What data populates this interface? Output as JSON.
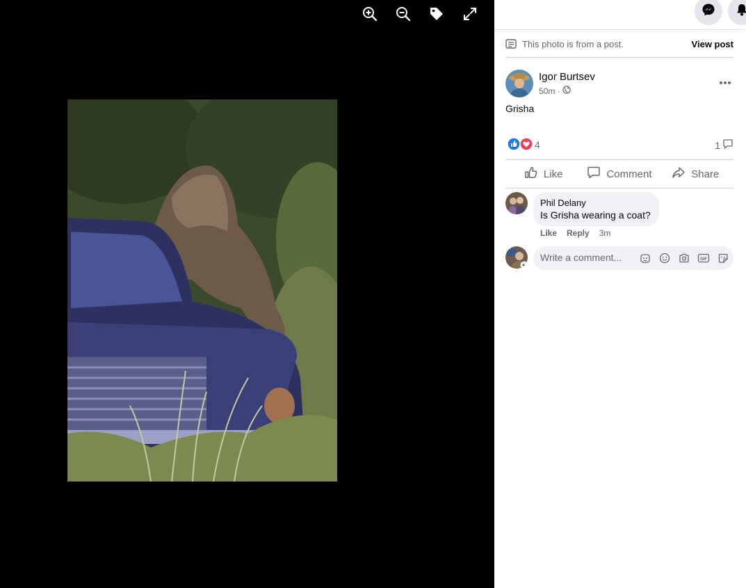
{
  "viewer": {
    "tools": [
      {
        "name": "zoom-in-icon"
      },
      {
        "name": "zoom-out-icon"
      },
      {
        "name": "tag-icon"
      },
      {
        "name": "fullscreen-icon"
      }
    ]
  },
  "topbar": {
    "buttons": [
      {
        "name": "messenger-icon"
      },
      {
        "name": "notifications-icon"
      }
    ]
  },
  "post_notice": {
    "text": "This photo is from a post.",
    "view_post_label": "View post"
  },
  "author": {
    "name": "Igor Burtsev",
    "time": "50m ·",
    "audience_icon": "globe-icon"
  },
  "caption": "Grisha",
  "reactions": {
    "count": "4",
    "types": [
      "like",
      "love"
    ],
    "comments_count": "1"
  },
  "actions": {
    "like": "Like",
    "comment": "Comment",
    "share": "Share"
  },
  "comments": [
    {
      "author": "Phil Delany",
      "text": "Is Grisha wearing a coat?",
      "like_label": "Like",
      "reply_label": "Reply",
      "time": "3m"
    }
  ],
  "composer": {
    "placeholder": "Write a comment...",
    "icons": [
      "avatar-sticker-icon",
      "emoji-icon",
      "camera-icon",
      "gif-icon",
      "sticker-icon"
    ]
  },
  "colors": {
    "like_blue": "#1877f2",
    "love_red": "#f33e58",
    "viewer_bg": "#000000",
    "secondary_text": "#65676b"
  }
}
